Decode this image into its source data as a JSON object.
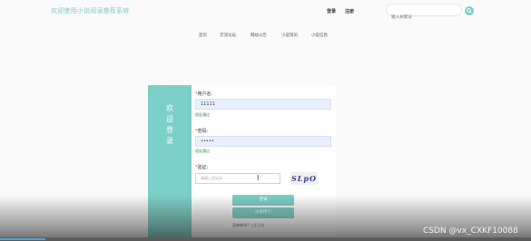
{
  "header": {
    "site_title": "欢迎使用小说阅读推荐系统",
    "login": "登录",
    "register": "注册",
    "search_placeholder": "输入关键词"
  },
  "nav": {
    "items": [
      {
        "label": "首页"
      },
      {
        "label": "交流论坛"
      },
      {
        "label": "网站公告"
      },
      {
        "label": "小说资讯"
      },
      {
        "label": "小说信息"
      }
    ]
  },
  "login_form": {
    "side_title": "欢迎登录",
    "username": {
      "label": "用户名:",
      "value": "11111",
      "valid_msg": "验证通过"
    },
    "password": {
      "label": "密码:",
      "value": "•••••",
      "valid_msg": "验证通过"
    },
    "captcha": {
      "label": "验证:",
      "placeholder": "请输入验证码",
      "image_text": "SLpO"
    },
    "login_button": "登录",
    "register_button": "注册用户",
    "no_account_text": "没有帐号?",
    "register_now": "立即注册"
  },
  "watermark": "CSDN @vx_CXKF10088",
  "colors": {
    "accent": "#7ccfc6",
    "input_bg": "#e8f0fe",
    "valid": "#2e7d32"
  }
}
